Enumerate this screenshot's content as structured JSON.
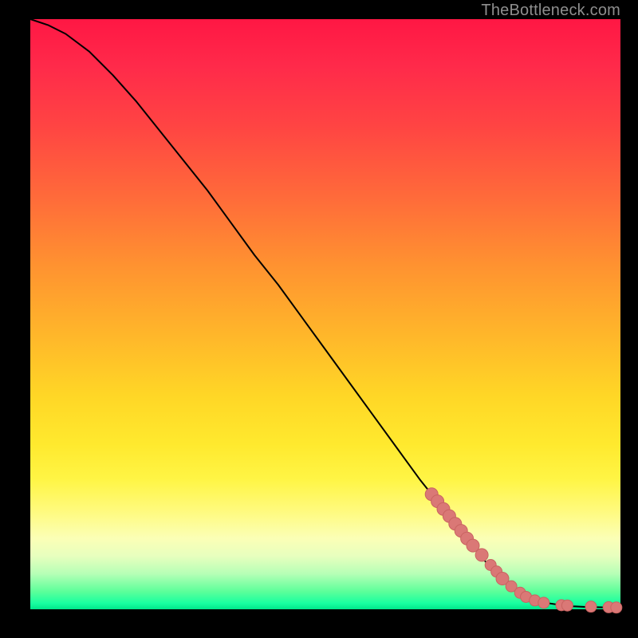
{
  "watermark": "TheBottleneck.com",
  "colors": {
    "curve_stroke": "#000000",
    "marker_fill": "#da7876",
    "marker_stroke": "#c96361"
  },
  "chart_data": {
    "type": "line",
    "title": "",
    "xlabel": "",
    "ylabel": "",
    "xlim": [
      0,
      100
    ],
    "ylim": [
      0,
      100
    ],
    "grid": false,
    "legend": false,
    "series": [
      {
        "name": "curve",
        "x": [
          0,
          3,
          6,
          10,
          14,
          18,
          22,
          26,
          30,
          34,
          38,
          42,
          46,
          50,
          54,
          58,
          62,
          66,
          70,
          74,
          78,
          80,
          82,
          84,
          86,
          88,
          90,
          92,
          94,
          96,
          98,
          100
        ],
        "y": [
          100,
          99,
          97.5,
          94.5,
          90.5,
          86,
          81,
          76,
          71,
          65.5,
          60,
          55,
          49.5,
          44,
          38.5,
          33,
          27.5,
          22,
          17,
          12,
          7,
          5,
          3.5,
          2.3,
          1.5,
          1,
          0.7,
          0.5,
          0.4,
          0.35,
          0.3,
          0.3
        ]
      }
    ],
    "markers": {
      "name": "points",
      "x": [
        68,
        69,
        70,
        71,
        72,
        73,
        74,
        75,
        76.5,
        78,
        79,
        80,
        81.5,
        83,
        84,
        85.5,
        87,
        90,
        91,
        95,
        98,
        99.3
      ],
      "y": [
        19.5,
        18.3,
        17,
        15.8,
        14.5,
        13.3,
        12,
        10.8,
        9.2,
        7.5,
        6.4,
        5.2,
        3.9,
        2.8,
        2.1,
        1.5,
        1.1,
        0.7,
        0.65,
        0.45,
        0.35,
        0.3
      ],
      "r": [
        8,
        8,
        8,
        8,
        8,
        8,
        8,
        8,
        8,
        7,
        7,
        8,
        7,
        7,
        7,
        7,
        7,
        7,
        7,
        7,
        7,
        7
      ]
    }
  }
}
